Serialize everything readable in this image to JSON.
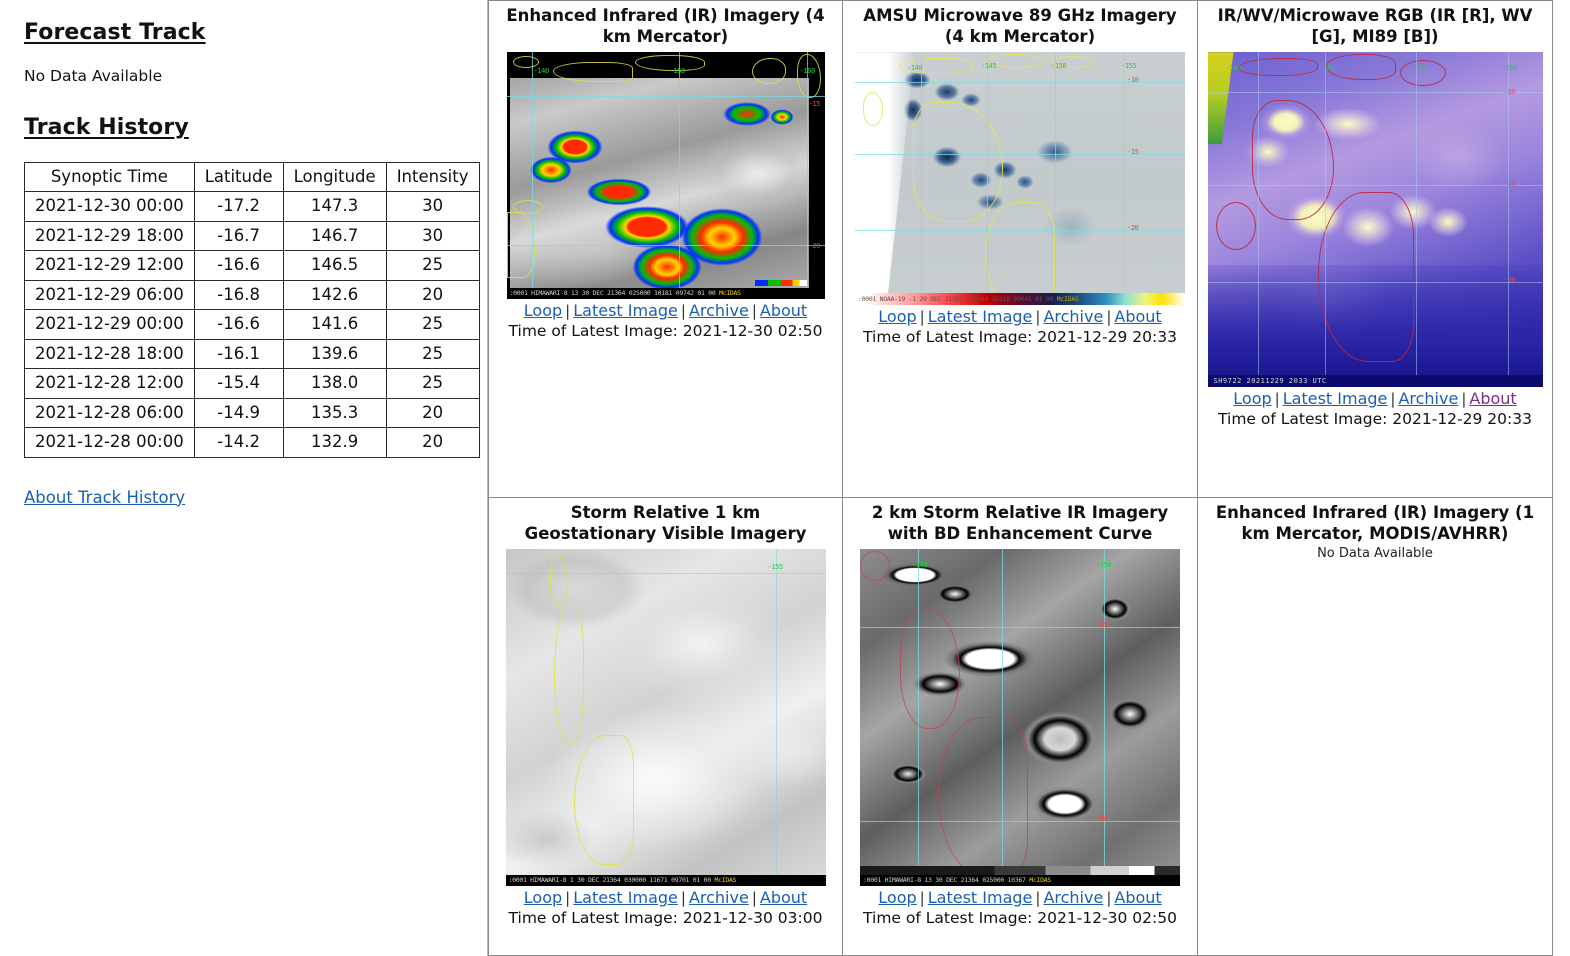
{
  "left_panel": {
    "forecast_track_title": "Forecast Track",
    "forecast_no_data": "No Data Available",
    "track_history_title": "Track History",
    "table": {
      "headers": [
        "Synoptic Time",
        "Latitude",
        "Longitude",
        "Intensity"
      ],
      "rows": [
        [
          "2021-12-30 00:00",
          "-17.2",
          "147.3",
          "30"
        ],
        [
          "2021-12-29 18:00",
          "-16.7",
          "146.7",
          "30"
        ],
        [
          "2021-12-29 12:00",
          "-16.6",
          "146.5",
          "25"
        ],
        [
          "2021-12-29 06:00",
          "-16.8",
          "142.6",
          "20"
        ],
        [
          "2021-12-29 00:00",
          "-16.6",
          "141.6",
          "25"
        ],
        [
          "2021-12-28 18:00",
          "-16.1",
          "139.6",
          "25"
        ],
        [
          "2021-12-28 12:00",
          "-15.4",
          "138.0",
          "25"
        ],
        [
          "2021-12-28 06:00",
          "-14.9",
          "135.3",
          "20"
        ],
        [
          "2021-12-28 00:00",
          "-14.2",
          "132.9",
          "20"
        ]
      ]
    },
    "about_track_history_link": "About Track History"
  },
  "link_labels": {
    "loop": "Loop",
    "latest_image": "Latest Image",
    "archive": "Archive",
    "about": "About",
    "separator": "|",
    "time_prefix": "Time of Latest Image:"
  },
  "panels": [
    {
      "id": "enhanced-ir-4km",
      "title_line1": "Enhanced Infrared (IR) Imagery (4",
      "title_line2": "km Mercator)",
      "has_image": true,
      "time_of_latest_image": "2021-12-30 02:50",
      "caption_time": "Time of Latest Image: 2021-12-30 02:50",
      "image_footer_text": ":0001 HIMAWARI-8 13 30 DEC 21364 025000 10181 09742 01 00",
      "image_footer_brand": "McIDAS",
      "lon_labels": [
        "-140",
        "-150",
        "-160"
      ],
      "lat_labels": [
        "-15",
        "-20"
      ],
      "about_visited": false
    },
    {
      "id": "amsu-microwave-89ghz",
      "title_line1": "AMSU Microwave 89 GHz Imagery",
      "title_line2": "(4 km Mercator)",
      "has_image": true,
      "time_of_latest_image": "2021-12-29 20:33",
      "caption_time": "Time of Latest Image: 2021-12-29 20:33",
      "image_footer_text": ":0001 NOAA-19  -1 29 DEC 21363 203344 16218 09641 01 00",
      "image_footer_brand": "McIDAS",
      "lon_labels": [
        "-140",
        "-145",
        "-150",
        "-155"
      ],
      "lat_labels": [
        "-10",
        "-15",
        "-20"
      ],
      "about_visited": false
    },
    {
      "id": "ir-wv-microwave-rgb",
      "title_line1": "IR/WV/Microwave RGB (IR [R], WV",
      "title_line2": "[G], MI89 [B])",
      "has_image": true,
      "time_of_latest_image": "2021-12-29 20:33",
      "caption_time": "Time of Latest Image: 2021-12-29 20:33",
      "image_footer_text": "SH9722 20211229 2033 UTC",
      "image_footer_brand": "",
      "lon_labels": [
        "-140",
        "-145",
        "-150",
        "-155"
      ],
      "lat_labels": [
        "-10",
        "-15",
        "-20"
      ],
      "about_visited": true
    },
    {
      "id": "storm-relative-visible",
      "title_line1": "Storm Relative 1 km",
      "title_line2": "Geostationary Visible Imagery",
      "has_image": true,
      "time_of_latest_image": "2021-12-30 03:00",
      "caption_time": "Time of Latest Image: 2021-12-30 03:00",
      "image_footer_text": ":0001 HIMAWARI-8  1 30 DEC 21364 030000 11671 09701 01 00",
      "image_footer_brand": "McIDAS",
      "lon_labels": [
        "-155"
      ],
      "lat_labels": [],
      "about_visited": false
    },
    {
      "id": "storm-relative-ir-bd",
      "title_line1": "2 km Storm Relative IR Imagery",
      "title_line2": "with BD Enhancement Curve",
      "has_image": true,
      "time_of_latest_image": "2021-12-30 02:50",
      "caption_time": "Time of Latest Image: 2021-12-30 02:50",
      "image_footer_text": ":0001 HIMAWARI-8 13 30 DEC 21364 025000 10367",
      "image_footer_brand": "McIDAS",
      "lon_labels": [
        "-145",
        "-150"
      ],
      "lat_labels": [
        "-15",
        "-20"
      ],
      "about_visited": false
    },
    {
      "id": "enhanced-ir-1km-modis-avhrr",
      "title_line1": "Enhanced Infrared (IR) Imagery (1",
      "title_line2": "km Mercator, MODIS/AVHRR)",
      "has_image": false,
      "no_data_text": "No Data Available",
      "about_visited": false
    }
  ],
  "colors": {
    "link": "#1a5fb4",
    "link_visited": "#7b2d8b",
    "border": "#8a8a8a",
    "text": "#111111"
  }
}
